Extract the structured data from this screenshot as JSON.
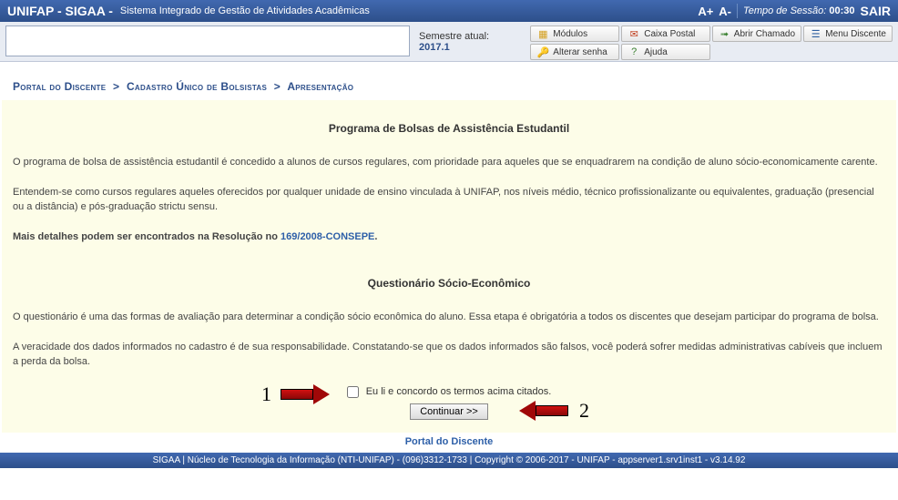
{
  "topbar": {
    "brand": "UNIFAP - SIGAA -",
    "subtitle": "Sistema Integrado de Gestão de Atividades Acadêmicas",
    "font_plus": "A+",
    "font_minus": "A-",
    "session_label": "Tempo de Sessão:",
    "session_time": "00:30",
    "exit": "SAIR"
  },
  "toolbar": {
    "semester_label": "Semestre atual:",
    "semester_value": "2017.1",
    "modules": "Módulos",
    "mailbox": "Caixa Postal",
    "chamado": "Abrir Chamado",
    "discente_menu": "Menu Discente",
    "alterar_senha": "Alterar senha",
    "ajuda": "Ajuda"
  },
  "breadcrumb": {
    "p1": "Portal do Discente",
    "p2": "Cadastro Único de Bolsistas",
    "p3": "Apresentação"
  },
  "content": {
    "title1": "Programa de Bolsas de Assistência Estudantil",
    "para1": "O programa de bolsa de assistência estudantil é concedido a alunos de cursos regulares, com prioridade para aqueles que se enquadrarem na condição de aluno sócio-economicamente carente.",
    "para2": "Entendem-se como cursos regulares aqueles oferecidos por qualquer unidade de ensino vinculada à UNIFAP, nos níveis médio, técnico profissionalizante ou equivalentes, graduação (presencial ou a distância) e pós-graduação strictu sensu.",
    "para3_prefix": "Mais detalhes podem ser encontrados na Resolução no ",
    "para3_link": "169/2008-CONSEPE",
    "para3_suffix": ".",
    "title2": "Questionário Sócio-Econômico",
    "para4": "O questionário é uma das formas de avaliação para determinar a condição sócio econômica do aluno. Essa etapa é obrigatória a todos os discentes que desejam participar do programa de bolsa.",
    "para5": "A veracidade dos dados informados no cadastro é de sua responsabilidade. Constatando-se que os dados informados são falsos, você poderá sofrer medidas administrativas cabíveis que incluem a perda da bolsa.",
    "agree_label": "Eu li e concordo os termos acima citados.",
    "continue_label": "Continuar >>",
    "num1": "1",
    "num2": "2"
  },
  "portal_link": "Portal do Discente",
  "footer": "SIGAA | Núcleo de Tecnologia da Informação (NTI-UNIFAP) - (096)3312-1733 | Copyright © 2006-2017 - UNIFAP - appserver1.srv1inst1 - v3.14.92"
}
